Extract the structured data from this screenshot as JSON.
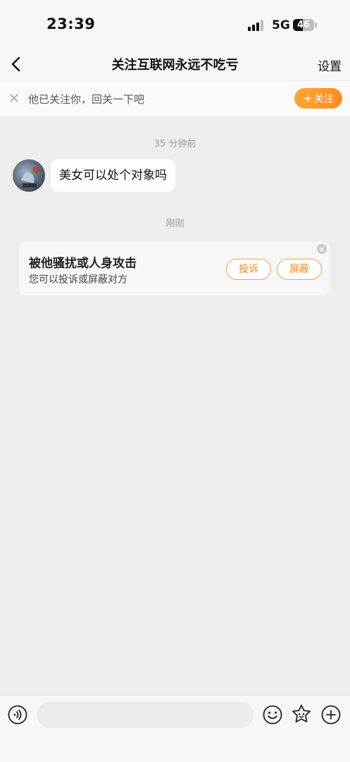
{
  "status_bar": {
    "time": "23:39",
    "network": "5G",
    "battery": "46",
    "battery_level": 0.46
  },
  "nav": {
    "title": "关注互联网永远不吃亏",
    "settings_label": "设置",
    "back_icon": "chevron-left-icon"
  },
  "follow_banner": {
    "text": "他已关注你，回关一下吧",
    "button_label": "关注",
    "button_prefix": "+",
    "close_icon": "close-icon"
  },
  "chat": {
    "messages": [
      {
        "timestamp": "35 分钟前",
        "text": "美女可以处个对象吗"
      }
    ],
    "notice_timestamp": "刚刚"
  },
  "harassment_card": {
    "title": "被他骚扰或人身攻击",
    "subtitle": "您可以投诉或屏蔽对方",
    "report_label": "投诉",
    "block_label": "屏蔽"
  },
  "input_bar": {
    "placeholder": "",
    "icons": [
      "voice-icon",
      "emoji-icon",
      "sticker-icon",
      "plus-icon"
    ]
  },
  "colors": {
    "accent": "#ff8a1f",
    "background": "#ededed"
  }
}
